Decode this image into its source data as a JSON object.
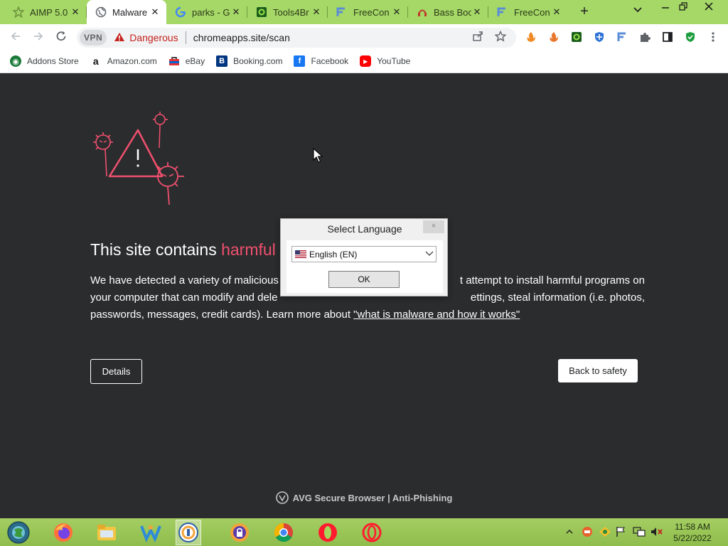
{
  "tabs": [
    {
      "title": "AIMP 5.0",
      "icon": "aimp-icon"
    },
    {
      "title": "Malware",
      "icon": "globe-icon",
      "active": true
    },
    {
      "title": "parks - G",
      "icon": "google-icon"
    },
    {
      "title": "Tools4Br",
      "icon": "tools4browser-icon"
    },
    {
      "title": "FreeCon",
      "icon": "freeconverter-icon"
    },
    {
      "title": "Bass Boo",
      "icon": "bass-booster-icon"
    },
    {
      "title": "FreeCon",
      "icon": "freeconverter-icon"
    }
  ],
  "omnibox": {
    "vpn_label": "VPN",
    "security_label": "Dangerous",
    "url": "chromeapps.site/scan"
  },
  "bookmarks": [
    {
      "label": "Addons Store",
      "icon": "addons-store-icon"
    },
    {
      "label": "Amazon.com",
      "icon": "amazon-icon"
    },
    {
      "label": "eBay",
      "icon": "ebay-icon"
    },
    {
      "label": "Booking.com",
      "icon": "booking-icon"
    },
    {
      "label": "Facebook",
      "icon": "facebook-icon"
    },
    {
      "label": "YouTube",
      "icon": "youtube-icon"
    }
  ],
  "page": {
    "heading_prefix": "This site contains ",
    "heading_highlight": "harmful",
    "body_line_1_left": "We have detected a variety of malicious",
    "body_line_1_right": "t attempt to install harmful programs on",
    "body_line_2_left": "your computer that can modify and dele",
    "body_line_2_right": "ettings, steal information (i.e. photos,",
    "body_line_3": "passwords, messages, credit cards). Learn more about ",
    "learn_more_link": "\"what is malware and how it works\"",
    "details_button": "Details",
    "back_button": "Back to safety",
    "footer": "AVG Secure Browser | Anti-Phishing"
  },
  "dialog": {
    "title": "Select Language",
    "close": "×",
    "selected_language": "English (EN)",
    "ok_button": "OK"
  },
  "taskbar": {
    "time": "11:58 AM",
    "date": "5/22/2022"
  },
  "colors": {
    "tabstrip": "#a5d867",
    "page_background": "#2b2c2e",
    "danger": "#c5221f",
    "highlight": "#f0506e"
  }
}
